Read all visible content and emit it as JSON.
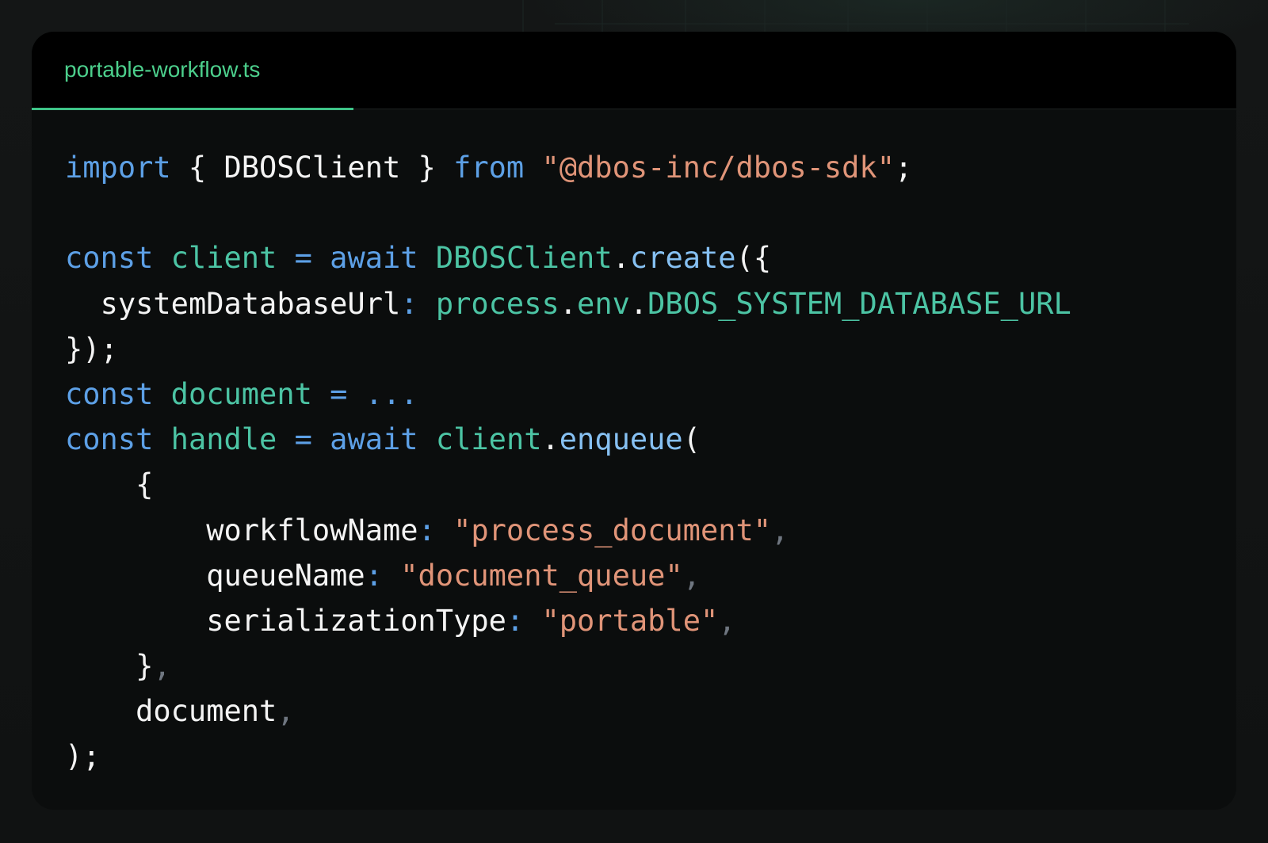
{
  "file_tab": {
    "label": "portable-workflow.ts",
    "active": true
  },
  "colors": {
    "keyword": "#5da0e6",
    "variable": "#4cc4a4",
    "string": "#e09478",
    "method": "#86c0f2",
    "plain": "#f4f4f4",
    "comma": "#6f7680",
    "tab_accent": "#4ccf8c",
    "editor_bg": "#0b0d0d",
    "tabbar_bg": "#000000"
  },
  "code": {
    "lines": [
      [
        {
          "t": "import",
          "c": "keyword"
        },
        {
          "t": " { ",
          "c": "punct"
        },
        {
          "t": "DBOSClient",
          "c": "prop"
        },
        {
          "t": " } ",
          "c": "punct"
        },
        {
          "t": "from",
          "c": "keyword"
        },
        {
          "t": " ",
          "c": "punct"
        },
        {
          "t": "\"@dbos-inc/dbos-sdk\"",
          "c": "string"
        },
        {
          "t": ";",
          "c": "punct"
        }
      ],
      [],
      [
        {
          "t": "const",
          "c": "keyword"
        },
        {
          "t": " ",
          "c": "punct"
        },
        {
          "t": "client",
          "c": "var"
        },
        {
          "t": " ",
          "c": "punct"
        },
        {
          "t": "=",
          "c": "op"
        },
        {
          "t": " ",
          "c": "punct"
        },
        {
          "t": "await",
          "c": "keyword"
        },
        {
          "t": " ",
          "c": "punct"
        },
        {
          "t": "DBOSClient",
          "c": "class"
        },
        {
          "t": ".",
          "c": "punct"
        },
        {
          "t": "create",
          "c": "method"
        },
        {
          "t": "({",
          "c": "punct"
        }
      ],
      [
        {
          "t": "  ",
          "c": "punct"
        },
        {
          "t": "systemDatabaseUrl",
          "c": "prop"
        },
        {
          "t": ":",
          "c": "colon"
        },
        {
          "t": " ",
          "c": "punct"
        },
        {
          "t": "process",
          "c": "env"
        },
        {
          "t": ".",
          "c": "punct"
        },
        {
          "t": "env",
          "c": "env"
        },
        {
          "t": ".",
          "c": "punct"
        },
        {
          "t": "DBOS_SYSTEM_DATABASE_URL",
          "c": "env"
        }
      ],
      [
        {
          "t": "});",
          "c": "punct"
        }
      ],
      [
        {
          "t": "const",
          "c": "keyword"
        },
        {
          "t": " ",
          "c": "punct"
        },
        {
          "t": "document",
          "c": "var"
        },
        {
          "t": " ",
          "c": "punct"
        },
        {
          "t": "=",
          "c": "op"
        },
        {
          "t": " ",
          "c": "punct"
        },
        {
          "t": "...",
          "c": "op"
        }
      ],
      [
        {
          "t": "const",
          "c": "keyword"
        },
        {
          "t": " ",
          "c": "punct"
        },
        {
          "t": "handle",
          "c": "var"
        },
        {
          "t": " ",
          "c": "punct"
        },
        {
          "t": "=",
          "c": "op"
        },
        {
          "t": " ",
          "c": "punct"
        },
        {
          "t": "await",
          "c": "keyword"
        },
        {
          "t": " ",
          "c": "punct"
        },
        {
          "t": "client",
          "c": "var"
        },
        {
          "t": ".",
          "c": "punct"
        },
        {
          "t": "enqueue",
          "c": "method"
        },
        {
          "t": "(",
          "c": "punct"
        }
      ],
      [
        {
          "t": "    {",
          "c": "punct"
        }
      ],
      [
        {
          "t": "        ",
          "c": "punct"
        },
        {
          "t": "workflowName",
          "c": "prop"
        },
        {
          "t": ":",
          "c": "colon"
        },
        {
          "t": " ",
          "c": "punct"
        },
        {
          "t": "\"process_document\"",
          "c": "string"
        },
        {
          "t": ",",
          "c": "comma"
        }
      ],
      [
        {
          "t": "        ",
          "c": "punct"
        },
        {
          "t": "queueName",
          "c": "prop"
        },
        {
          "t": ":",
          "c": "colon"
        },
        {
          "t": " ",
          "c": "punct"
        },
        {
          "t": "\"document_queue\"",
          "c": "string"
        },
        {
          "t": ",",
          "c": "comma"
        }
      ],
      [
        {
          "t": "        ",
          "c": "punct"
        },
        {
          "t": "serializationType",
          "c": "prop"
        },
        {
          "t": ":",
          "c": "colon"
        },
        {
          "t": " ",
          "c": "punct"
        },
        {
          "t": "\"portable\"",
          "c": "string"
        },
        {
          "t": ",",
          "c": "comma"
        }
      ],
      [
        {
          "t": "    }",
          "c": "punct"
        },
        {
          "t": ",",
          "c": "comma"
        }
      ],
      [
        {
          "t": "    ",
          "c": "punct"
        },
        {
          "t": "document",
          "c": "prop"
        },
        {
          "t": ",",
          "c": "comma"
        }
      ],
      [
        {
          "t": ");",
          "c": "punct"
        }
      ]
    ]
  }
}
